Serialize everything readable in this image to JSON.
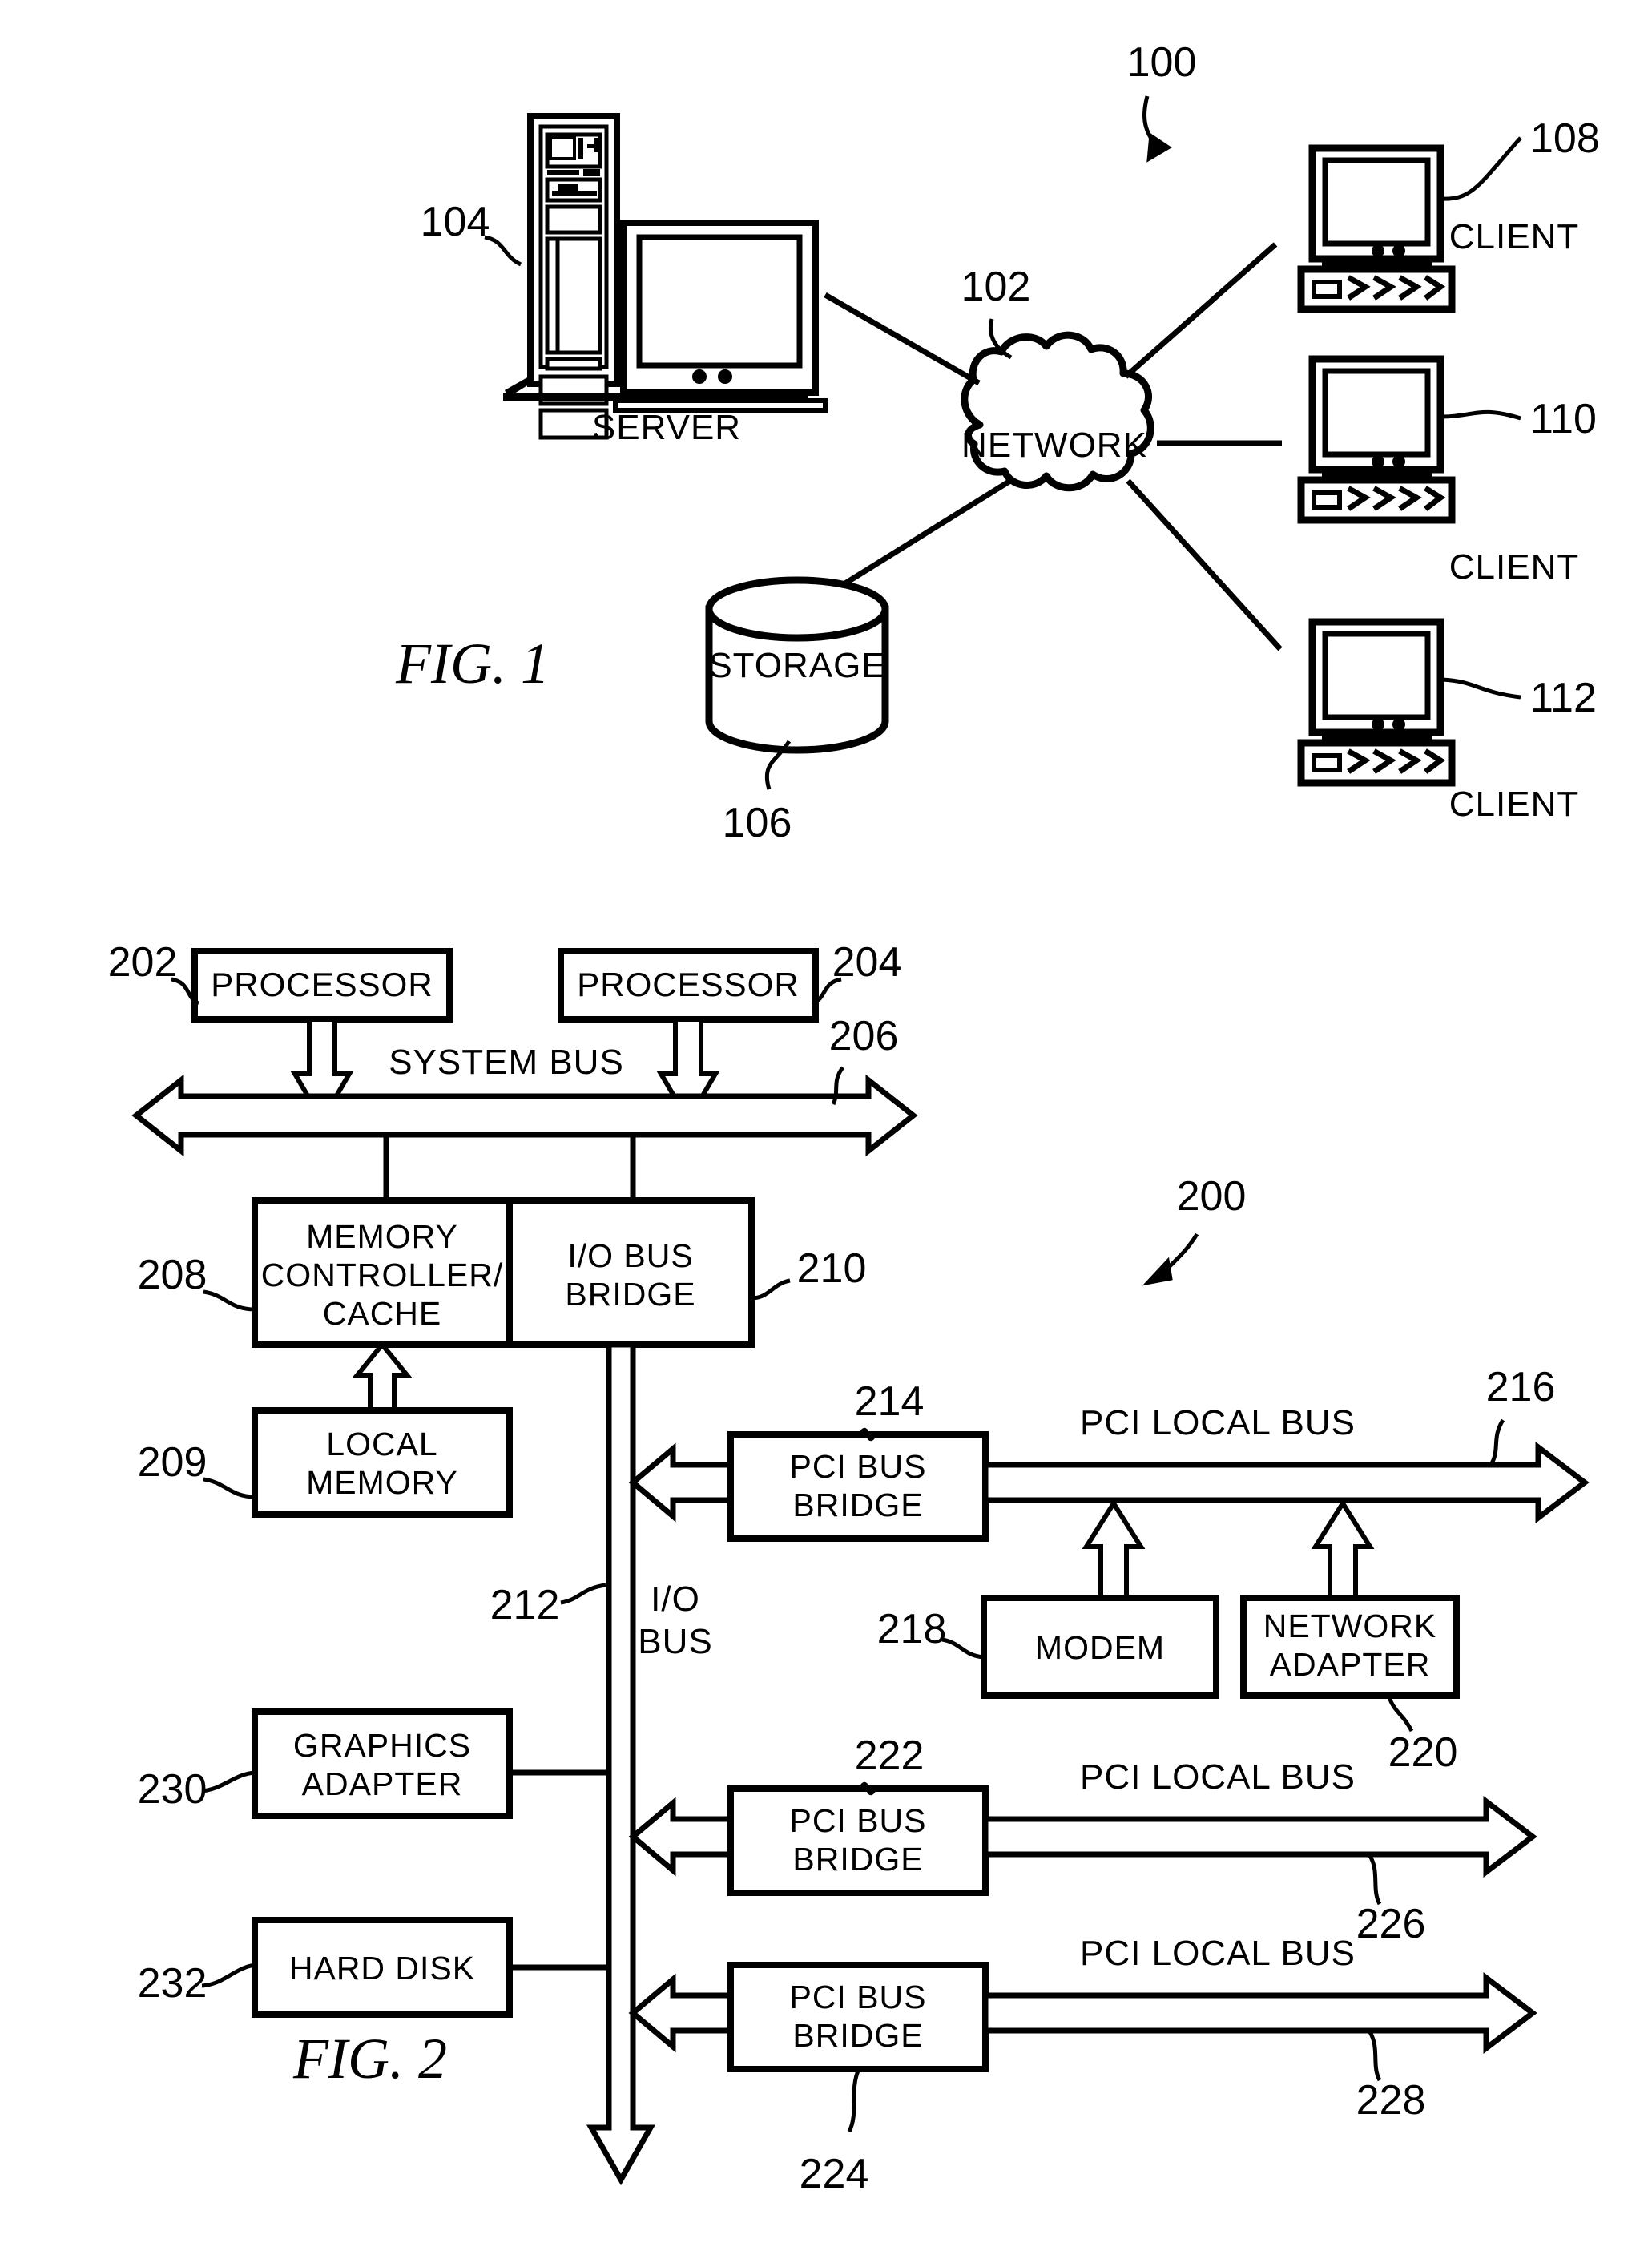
{
  "document": {
    "type": "patent-drawing-sheet",
    "figures": [
      "FIG. 1",
      "FIG. 2"
    ]
  },
  "fig1": {
    "label": "FIG. 1",
    "system_ref": "100",
    "nodes": {
      "server": {
        "caption": "SERVER",
        "ref": "104"
      },
      "network": {
        "caption": "NETWORK",
        "ref": "102"
      },
      "storage": {
        "caption": "STORAGE",
        "ref": "106"
      },
      "client_top": {
        "caption": "CLIENT",
        "ref": "108"
      },
      "client_mid": {
        "caption": "CLIENT",
        "ref": "110"
      },
      "client_bottom": {
        "caption": "CLIENT",
        "ref": "112"
      }
    }
  },
  "fig2": {
    "label": "FIG. 2",
    "system_ref": "200",
    "blocks": {
      "processor_left": {
        "text": "PROCESSOR",
        "ref": "202"
      },
      "processor_right": {
        "text": "PROCESSOR",
        "ref": "204"
      },
      "memory_controller": {
        "line1": "MEMORY",
        "line2": "CONTROLLER/",
        "line3": "CACHE",
        "ref": "208"
      },
      "io_bus_bridge": {
        "line1": "I/O BUS",
        "line2": "BRIDGE",
        "ref": "210"
      },
      "local_memory": {
        "line1": "LOCAL",
        "line2": "MEMORY",
        "ref": "209"
      },
      "graphics_adapter": {
        "line1": "GRAPHICS",
        "line2": "ADAPTER",
        "ref": "230"
      },
      "hard_disk": {
        "text": "HARD DISK",
        "ref": "232"
      },
      "pci_bridge_1": {
        "line1": "PCI BUS",
        "line2": "BRIDGE",
        "ref": "214"
      },
      "pci_bridge_2": {
        "line1": "PCI BUS",
        "line2": "BRIDGE",
        "ref": "222"
      },
      "pci_bridge_3": {
        "line1": "PCI BUS",
        "line2": "BRIDGE",
        "ref": "224"
      },
      "modem": {
        "text": "MODEM",
        "ref": "218"
      },
      "network_adapter": {
        "line1": "NETWORK",
        "line2": "ADAPTER",
        "ref": "220"
      }
    },
    "buses": {
      "system_bus": {
        "text": "SYSTEM BUS",
        "ref": "206"
      },
      "io_bus": {
        "line1": "I/O",
        "line2": "BUS",
        "ref": "212"
      },
      "pci_local_bus_1": {
        "text": "PCI LOCAL BUS",
        "ref": "216"
      },
      "pci_local_bus_2": {
        "text": "PCI LOCAL BUS",
        "ref": "226"
      },
      "pci_local_bus_3": {
        "text": "PCI LOCAL BUS",
        "ref": "228"
      }
    }
  },
  "colors": {
    "ink": "#000000",
    "paper": "#ffffff"
  }
}
